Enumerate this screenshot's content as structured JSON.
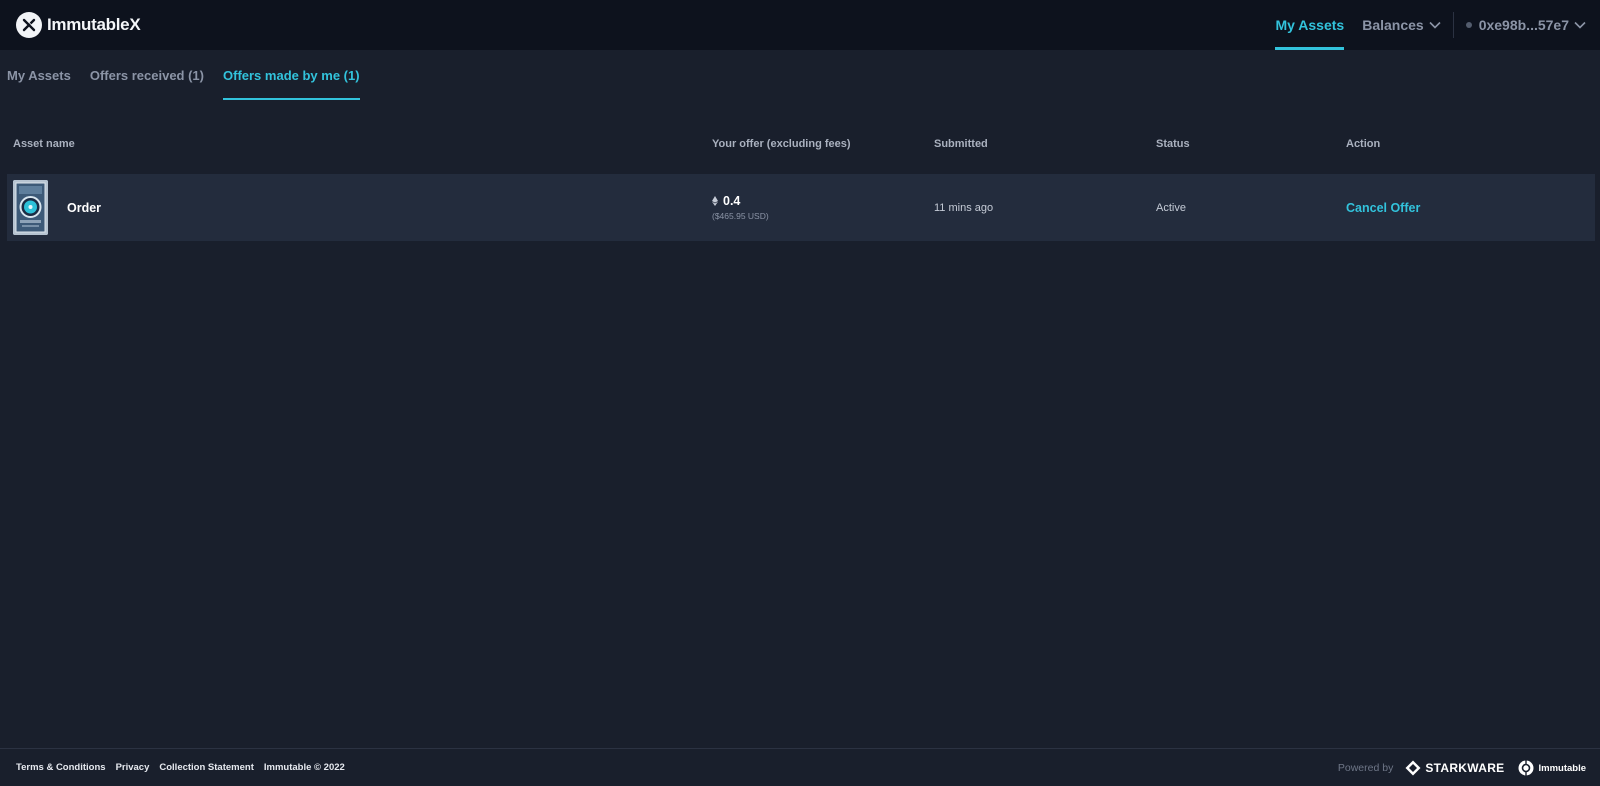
{
  "header": {
    "logo_text": "ImmutableX",
    "nav": {
      "my_assets": "My Assets",
      "balances": "Balances",
      "wallet": "0xe98b...57e7"
    }
  },
  "tabs": [
    {
      "label": "My Assets",
      "active": false
    },
    {
      "label": "Offers received (1)",
      "active": false
    },
    {
      "label": "Offers made by me (1)",
      "active": true
    }
  ],
  "table": {
    "columns": [
      "Asset name",
      "Your offer (excluding fees)",
      "Submitted",
      "Status",
      "Action"
    ],
    "rows": [
      {
        "asset_name": "Order",
        "offer_value": "0.4",
        "offer_usd": "($465.95 USD)",
        "submitted": "11 mins ago",
        "status": "Active",
        "action": "Cancel Offer"
      }
    ]
  },
  "footer": {
    "links": [
      "Terms & Conditions",
      "Privacy",
      "Collection Statement"
    ],
    "copyright": "Immutable © 2022",
    "powered_by": "Powered by",
    "brand_starkware": "STARKWARE",
    "brand_immutable": "Immutable"
  },
  "colors": {
    "accent": "#32c3dc",
    "background": "#191f2c",
    "header_bg": "#0d121d",
    "row_bg": "#232c3d"
  },
  "icons": {
    "logo": "immutablex-logo-icon",
    "dropdown": "chevron-down-icon",
    "currency": "eth-icon",
    "starkware": "starkware-logo-icon",
    "immutable": "immutable-logo-icon"
  }
}
